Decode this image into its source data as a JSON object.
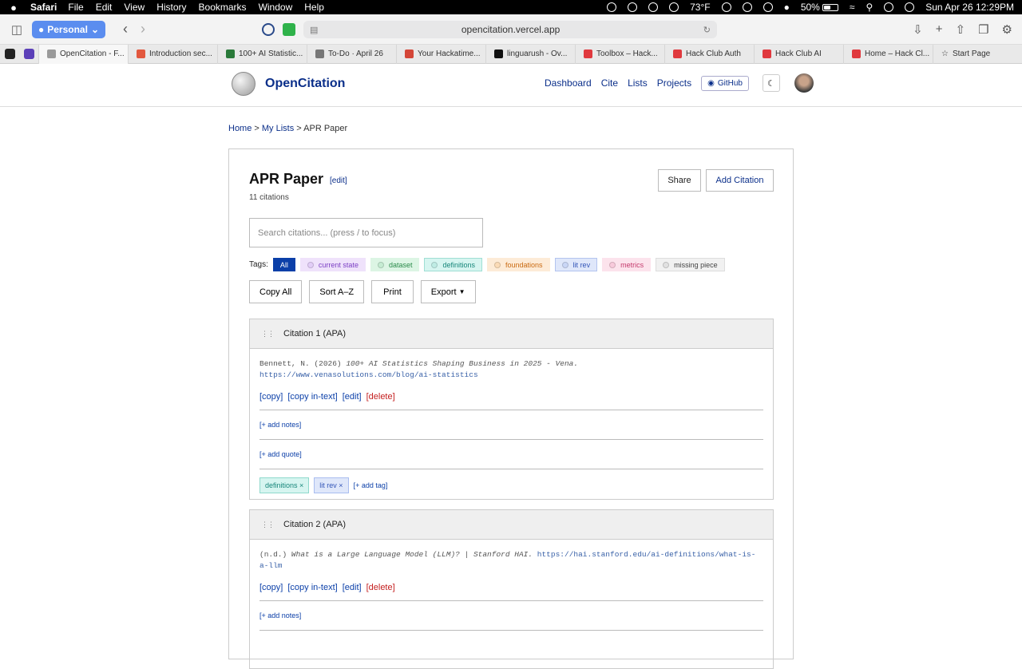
{
  "menubar": {
    "app": "Safari",
    "menus": [
      "File",
      "Edit",
      "View",
      "History",
      "Bookmarks",
      "Window",
      "Help"
    ],
    "weather": "73°F",
    "battery": "50%",
    "battery_level": 0.5,
    "datetime": "Sun Apr 26  12:29PM"
  },
  "toolbar": {
    "profile": "Personal",
    "url": "opencitation.vercel.app"
  },
  "tabs": [
    {
      "title": "OpenCitation - F...",
      "fav_color": "#9a9a9a",
      "active": true
    },
    {
      "title": "Introduction sec...",
      "fav_color": "#e2583e"
    },
    {
      "title": "100+ AI Statistic...",
      "fav_color": "#2a7a3a"
    },
    {
      "title": "To-Do · April 26",
      "fav_color": "#777777"
    },
    {
      "title": "Your Hackatime...",
      "fav_color": "#d44638"
    },
    {
      "title": "linguarush - Ov...",
      "fav_color": "#111111"
    },
    {
      "title": "Toolbox – Hack...",
      "fav_color": "#e0393e"
    },
    {
      "title": "Hack Club Auth",
      "fav_color": "#e0393e"
    },
    {
      "title": "Hack Club AI",
      "fav_color": "#e0393e"
    },
    {
      "title": "Home – Hack Cl...",
      "fav_color": "#e0393e"
    },
    {
      "title": "Start Page",
      "fav_color": "#888888"
    }
  ],
  "site": {
    "brand": "OpenCitation",
    "nav": [
      "Dashboard",
      "Cite",
      "Lists",
      "Projects"
    ],
    "github": "GitHub"
  },
  "breadcrumb": {
    "home": "Home",
    "lists": "My Lists",
    "current": "APR Paper"
  },
  "list": {
    "title": "APR Paper",
    "edit": "[edit]",
    "count": "11 citations",
    "share": "Share",
    "add_citation": "Add Citation",
    "search_placeholder": "Search citations... (press / to focus)",
    "tags_label": "Tags:",
    "tags": [
      {
        "label": "All",
        "bg": "#0b3fa8",
        "fg": "#ffffff",
        "dot": ""
      },
      {
        "label": "current state",
        "bg": "#efe2fb",
        "fg": "#7b3fc4",
        "dot": "#e2cdf7"
      },
      {
        "label": "dataset",
        "bg": "#dcf5e4",
        "fg": "#2a8a4a",
        "dot": "#c5ecd2"
      },
      {
        "label": "definitions",
        "bg": "#d6f5f0",
        "fg": "#17867a",
        "dot": "#bfece4"
      },
      {
        "label": "foundations",
        "bg": "#fdebd7",
        "fg": "#c96a12",
        "dot": "#fbdbb7"
      },
      {
        "label": "lit rev",
        "bg": "#dfe7fa",
        "fg": "#3355b8",
        "dot": "#c9d6f6"
      },
      {
        "label": "metrics",
        "bg": "#fce3ec",
        "fg": "#c43a6c",
        "dot": "#f8cadb"
      },
      {
        "label": "missing piece",
        "bg": "#f1f1f1",
        "fg": "#444444",
        "dot": "#e1e1e1"
      }
    ],
    "actions": [
      "Copy All",
      "Sort A–Z",
      "Print",
      "Export"
    ]
  },
  "citations": [
    {
      "header": "Citation 1 (APA)",
      "author": "Bennett, N. (2026)",
      "title_italic": "100+ AI Statistics Shaping Business in 2025 - Vena.",
      "url": "https://www.venasolutions.com/blog/ai-statistics",
      "actions": {
        "copy": "[copy]",
        "copy_intext": "[copy in-text]",
        "edit": "[edit]",
        "delete": "[delete]"
      },
      "add_notes": "[+ add notes]",
      "add_quote": "[+ add quote]",
      "tags": [
        {
          "label": "definitions ×",
          "bg": "#d6f5f0",
          "fg": "#17867a",
          "border": "#8fd9cc"
        },
        {
          "label": "lit rev ×",
          "bg": "#dfe7fa",
          "fg": "#3355b8",
          "border": "#a9bdf0"
        }
      ],
      "add_tag": "[+ add tag]"
    },
    {
      "header": "Citation 2 (APA)",
      "author": "(n.d.)",
      "title_italic": "What is a Large Language Model (LLM)? | Stanford HAI.",
      "url": "https://hai.stanford.edu/ai-definitions/what-is-a-llm",
      "actions": {
        "copy": "[copy]",
        "copy_intext": "[copy in-text]",
        "edit": "[edit]",
        "delete": "[delete]"
      },
      "add_notes": "[+ add notes]"
    }
  ]
}
